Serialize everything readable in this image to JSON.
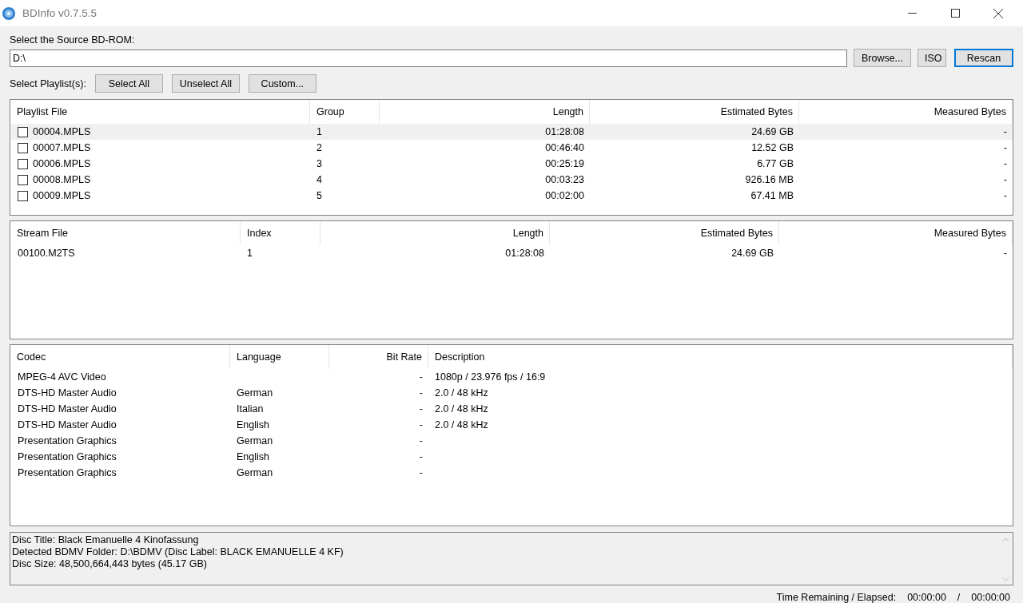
{
  "window": {
    "title": "BDInfo v0.7.5.5"
  },
  "source": {
    "label": "Select the Source BD-ROM:",
    "value": "D:\\",
    "buttons": [
      {
        "label": "Browse...",
        "focused": false
      },
      {
        "label": "ISO",
        "focused": false
      },
      {
        "label": "Rescan",
        "focused": true
      }
    ]
  },
  "playlist_select": {
    "label": "Select Playlist(s):",
    "buttons": [
      "Select All",
      "Unselect All",
      "Custom..."
    ]
  },
  "playlists": {
    "columns": [
      "Playlist File",
      "Group",
      "Length",
      "Estimated Bytes",
      "Measured Bytes"
    ],
    "rows": [
      {
        "cells": [
          "00004.MPLS",
          "1",
          "01:28:08",
          "24.69 GB",
          "-"
        ],
        "checked": false,
        "selected": true
      },
      {
        "cells": [
          "00007.MPLS",
          "2",
          "00:46:40",
          "12.52 GB",
          "-"
        ],
        "checked": false,
        "selected": false
      },
      {
        "cells": [
          "00006.MPLS",
          "3",
          "00:25:19",
          "6.77 GB",
          "-"
        ],
        "checked": false,
        "selected": false
      },
      {
        "cells": [
          "00008.MPLS",
          "4",
          "00:03:23",
          "926.16 MB",
          "-"
        ],
        "checked": false,
        "selected": false
      },
      {
        "cells": [
          "00009.MPLS",
          "5",
          "00:02:00",
          "67.41 MB",
          "-"
        ],
        "checked": false,
        "selected": false
      }
    ]
  },
  "streams": {
    "columns": [
      "Stream File",
      "Index",
      "Length",
      "Estimated Bytes",
      "Measured Bytes"
    ],
    "rows": [
      {
        "cells": [
          "00100.M2TS",
          "1",
          "01:28:08",
          "24.69 GB",
          "-"
        ]
      }
    ]
  },
  "codecs": {
    "columns": [
      "Codec",
      "Language",
      "Bit Rate",
      "Description"
    ],
    "rows": [
      {
        "cells": [
          "MPEG-4 AVC Video",
          "",
          "-",
          "1080p / 23.976 fps / 16:9"
        ]
      },
      {
        "cells": [
          "DTS-HD Master Audio",
          "German",
          "-",
          "2.0 / 48 kHz"
        ]
      },
      {
        "cells": [
          "DTS-HD Master Audio",
          "Italian",
          "-",
          "2.0 / 48 kHz"
        ]
      },
      {
        "cells": [
          "DTS-HD Master Audio",
          "English",
          "-",
          "2.0 / 48 kHz"
        ]
      },
      {
        "cells": [
          "Presentation Graphics",
          "German",
          "-",
          ""
        ]
      },
      {
        "cells": [
          "Presentation Graphics",
          "English",
          "-",
          ""
        ]
      },
      {
        "cells": [
          "Presentation Graphics",
          "German",
          "-",
          ""
        ]
      }
    ]
  },
  "report": {
    "lines": [
      "Disc Title: Black Emanuelle 4 Kinofassung",
      "Detected BDMV Folder: D:\\BDMV (Disc Label: BLACK EMANUELLE 4 KF)",
      "Disc Size: 48,500,664,443 bytes (45.17 GB)"
    ]
  },
  "status_bar": {
    "label": "Time Remaining / Elapsed:",
    "remaining": "00:00:00",
    "separator": "/",
    "elapsed": "00:00:00"
  }
}
